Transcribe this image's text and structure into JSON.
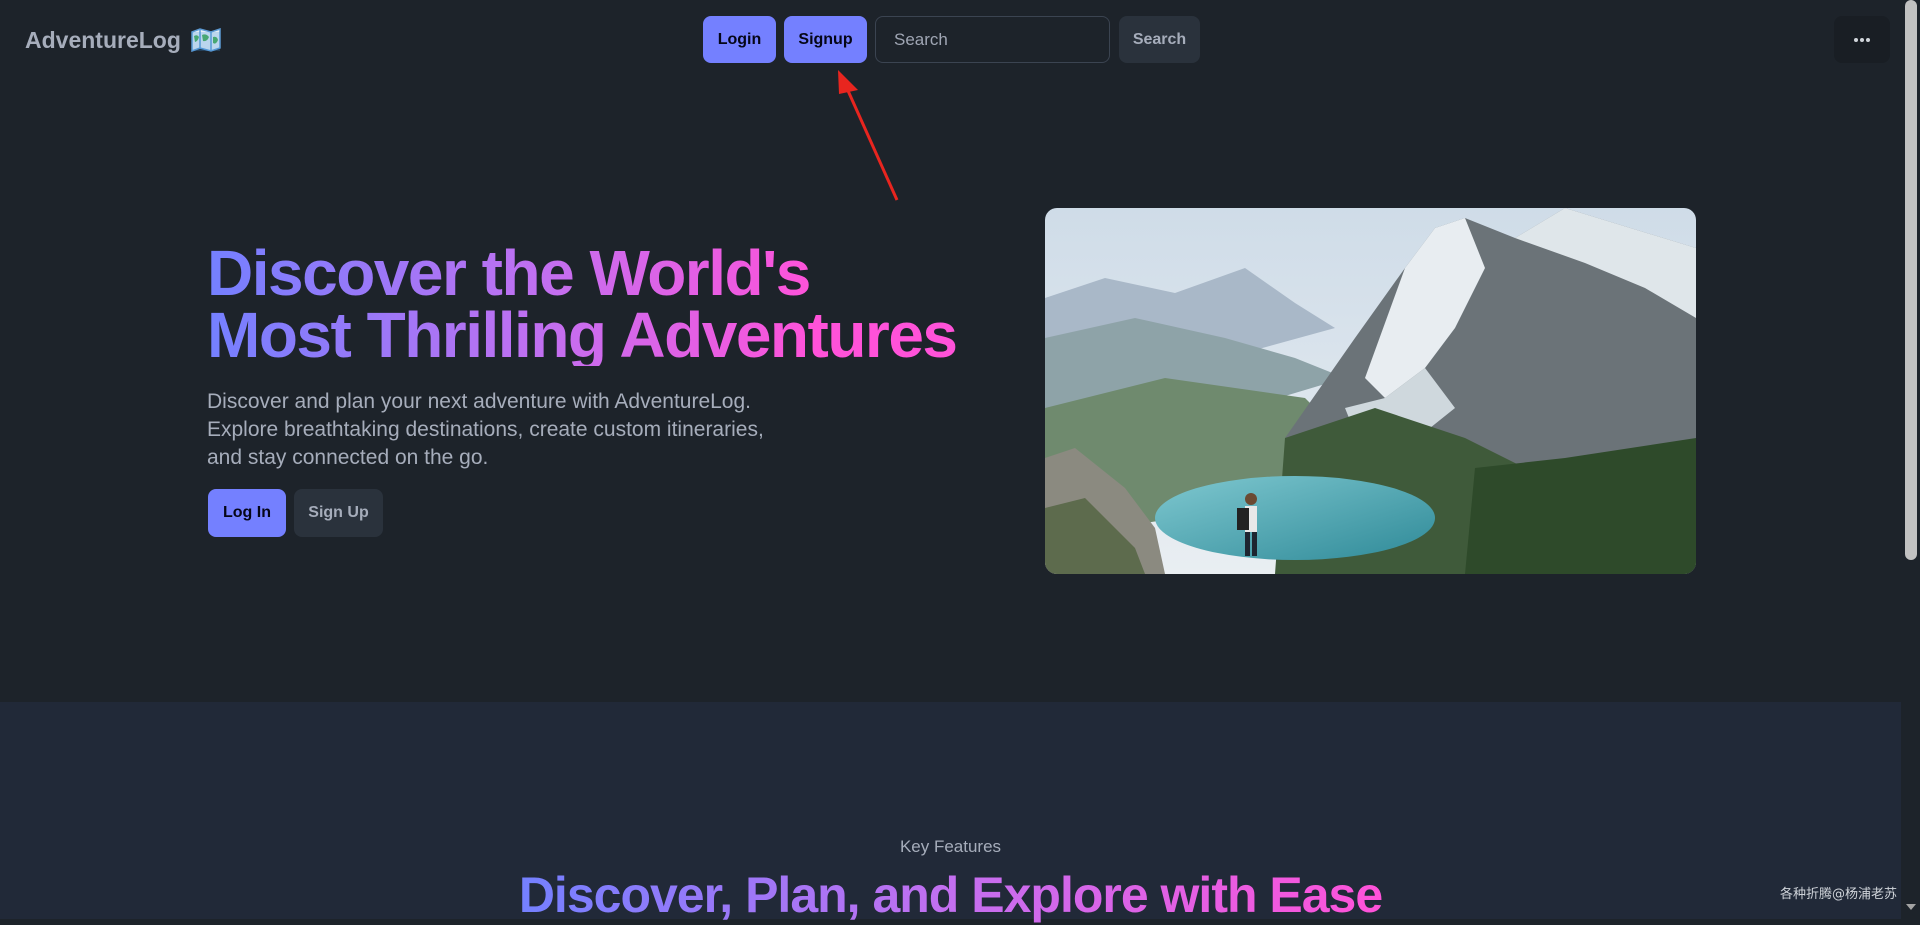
{
  "navbar": {
    "brand": "AdventureLog",
    "brand_icon": "world-map-icon",
    "login_label": "Login",
    "signup_label": "Signup",
    "search_placeholder": "Search",
    "search_button_label": "Search",
    "menu_icon": "more-dots-icon"
  },
  "hero": {
    "title": "Discover the World's Most Thrilling Adventures",
    "description": "Discover and plan your next adventure with AdventureLog. Explore breathtaking destinations, create custom itineraries, and stay connected on the go.",
    "login_label": "Log In",
    "signup_label": "Sign Up",
    "image_icon": "mountain-lake-photo"
  },
  "features": {
    "kicker": "Key Features",
    "title": "Discover, Plan, and Explore with Ease"
  },
  "watermark": "各种折腾@杨浦老苏",
  "colors": {
    "background": "#1d232a",
    "primary": "#7480ff",
    "secondary": "#ff52d9",
    "neutral": "#2a323c",
    "features_bg": "#212938",
    "annotation": "#e8251f"
  }
}
